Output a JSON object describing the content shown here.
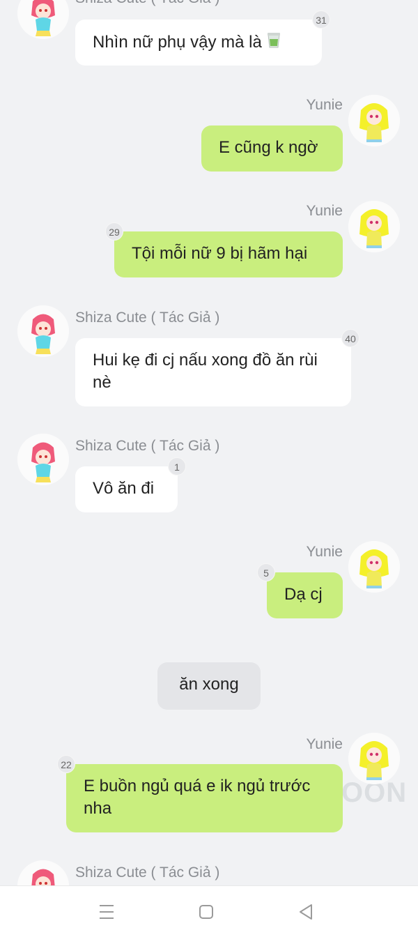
{
  "messages": [
    {
      "sender": "Shiza Cute ( Tác Giả )",
      "text": "Nhìn nữ phụ vậy mà là",
      "badge": "31",
      "emoji": "green-tea-icon"
    },
    {
      "sender": "Yunie",
      "text": "E cũng k ngờ"
    },
    {
      "sender": "Yunie",
      "text": "Tội mỗi nữ 9 bị hãm hại",
      "badge": "29"
    },
    {
      "sender": "Shiza Cute ( Tác Giả )",
      "text": "Hui kẹ đi cj nấu xong đồ ăn rùi nè",
      "badge": "40"
    },
    {
      "sender": "Shiza Cute ( Tác Giả )",
      "text": "Vô ăn đi",
      "badge": "1"
    },
    {
      "sender": "Yunie",
      "text": "Dạ cj",
      "badge": "5"
    },
    {
      "sender": "",
      "text": "ăn xong"
    },
    {
      "sender": "Yunie",
      "text": "E buồn ngủ quá e ik ngủ trước nha",
      "badge": "22"
    },
    {
      "sender": "Shiza Cute ( Tác Giả )",
      "text": ""
    }
  ],
  "watermark": "OON",
  "colors": {
    "background": "#f1f2f4",
    "incoming_bubble": "#ffffff",
    "outgoing_bubble": "#c9ee7e",
    "narration_bubble": "#e4e5e8",
    "name_text": "#8a8d92"
  },
  "navbar": {
    "icons": [
      "menu-icon",
      "home-square-icon",
      "back-triangle-icon"
    ]
  }
}
